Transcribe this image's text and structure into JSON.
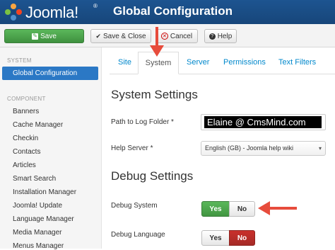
{
  "header": {
    "logo_text": "Joomla!",
    "logo_reg": "®",
    "title": "Global Configuration"
  },
  "toolbar": {
    "save_label": "Save",
    "save_close_label": "Save & Close",
    "cancel_label": "Cancel",
    "help_label": "Help"
  },
  "sidebar": {
    "system_heading": "SYSTEM",
    "active_item": "Global Configuration",
    "component_heading": "COMPONENT",
    "items": [
      "Banners",
      "Cache Manager",
      "Checkin",
      "Contacts",
      "Articles",
      "Smart Search",
      "Installation Manager",
      "Joomla! Update",
      "Language Manager",
      "Media Manager",
      "Menus Manager"
    ]
  },
  "tabs": [
    "Site",
    "System",
    "Server",
    "Permissions",
    "Text Filters"
  ],
  "active_tab": "System",
  "system_settings": {
    "title": "System Settings",
    "log_folder_label": "Path to Log Folder *",
    "log_folder_value": "Elaine @ CmsMind.com",
    "help_server_label": "Help Server *",
    "help_server_value": "English (GB) - Joomla help wiki"
  },
  "debug_settings": {
    "title": "Debug Settings",
    "debug_system_label": "Debug System",
    "debug_language_label": "Debug Language",
    "yes_label": "Yes",
    "no_label": "No",
    "debug_system": "Yes",
    "debug_language": "No"
  },
  "colors": {
    "header_bg": "#17467a",
    "save_green": "#46a546",
    "active_blue": "#2b78c5",
    "link_blue": "#0088cc",
    "no_red": "#bd362f",
    "annotation_arrow": "#e74c3c"
  }
}
